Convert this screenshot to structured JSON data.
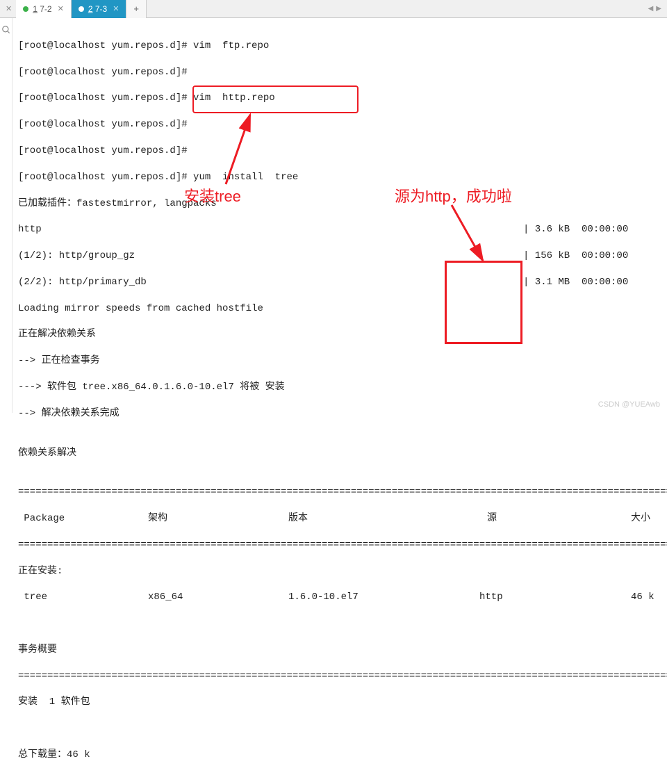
{
  "tabs": {
    "tab1_label": "1 7-2",
    "tab2_label": "2 7-3",
    "plus": "+"
  },
  "terminal": {
    "l1": "[root@localhost yum.repos.d]# vim  ftp.repo",
    "l2": "[root@localhost yum.repos.d]#",
    "l3": "[root@localhost yum.repos.d]# vim  http.repo",
    "l4": "[root@localhost yum.repos.d]#",
    "l5": "[root@localhost yum.repos.d]#",
    "l6_prompt": "[root@localhost yum.repos.d]#",
    "l6_cmd": " yum  install  tree",
    "l7": "已加载插件：fastestmirror, langpacks",
    "l8_left": "http",
    "l8_right": "| 3.6 kB  00:00:00",
    "l9_left": "(1/2): http/group_gz",
    "l9_right": "| 156 kB  00:00:00",
    "l10_left": "(2/2): http/primary_db",
    "l10_right": "| 3.1 MB  00:00:00",
    "l11": "Loading mirror speeds from cached hostfile",
    "l12": "正在解决依赖关系",
    "l13": "--> 正在检查事务",
    "l14": "---> 软件包 tree.x86_64.0.1.6.0-10.el7 将被 安装",
    "l15": "--> 解决依赖关系完成",
    "l16": "",
    "l17": "依赖关系解决",
    "l18": "",
    "sep": "================================================================================================================",
    "hdr_pkg": " Package",
    "hdr_arch": "架构",
    "hdr_ver": "版本",
    "hdr_src": "源",
    "hdr_size": "大小",
    "installing": "正在安装:",
    "row_pkg": " tree",
    "row_arch": "x86_64",
    "row_ver": "1.6.0-10.el7",
    "row_src": "http",
    "row_size": "46 k",
    "summary": "事务概要",
    "install_count": "安装  1 软件包",
    "total_dl": "总下载量：46 k"
  },
  "annotations": {
    "install_tree": "安装tree",
    "src_http": "源为http，成功啦"
  },
  "watermark": "CSDN @YUEAwb"
}
